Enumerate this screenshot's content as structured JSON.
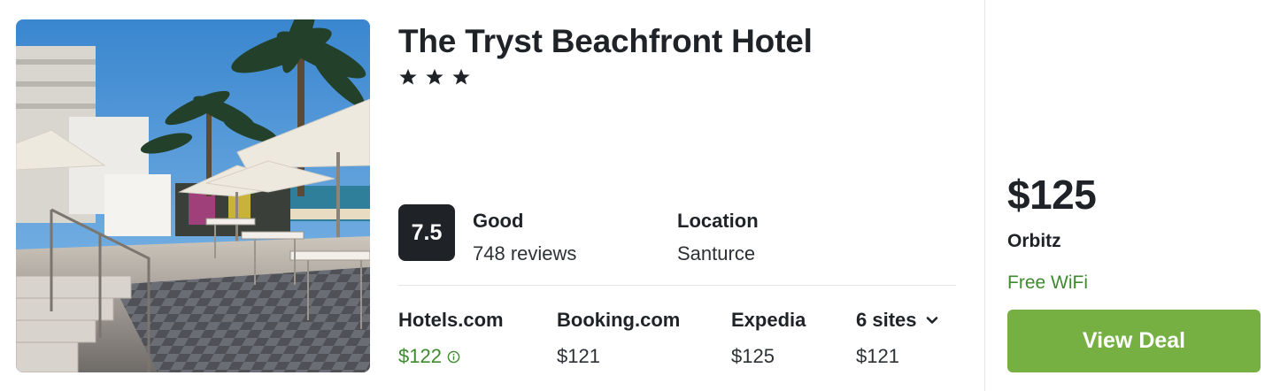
{
  "hotel": {
    "name": "The Tryst Beachfront Hotel",
    "star_rating": 3,
    "score": "7.5",
    "rating_word": "Good",
    "reviews": "748 reviews",
    "location_label": "Location",
    "location_value": "Santurce"
  },
  "providers": [
    {
      "name": "Hotels.com",
      "price": "$122",
      "best": true
    },
    {
      "name": "Booking.com",
      "price": "$121"
    },
    {
      "name": "Expedia",
      "price": "$125"
    }
  ],
  "more_sites": {
    "label": "6 sites",
    "price": "$121"
  },
  "deal": {
    "price": "$125",
    "provider": "Orbitz",
    "amenity": "Free WiFi",
    "button_label": "View Deal"
  },
  "colors": {
    "accent_green": "#76b043",
    "price_green": "#3f8a2f",
    "score_bg": "#1f2328"
  },
  "icons": [
    "star-icon",
    "info-icon",
    "chevron-down-icon"
  ]
}
